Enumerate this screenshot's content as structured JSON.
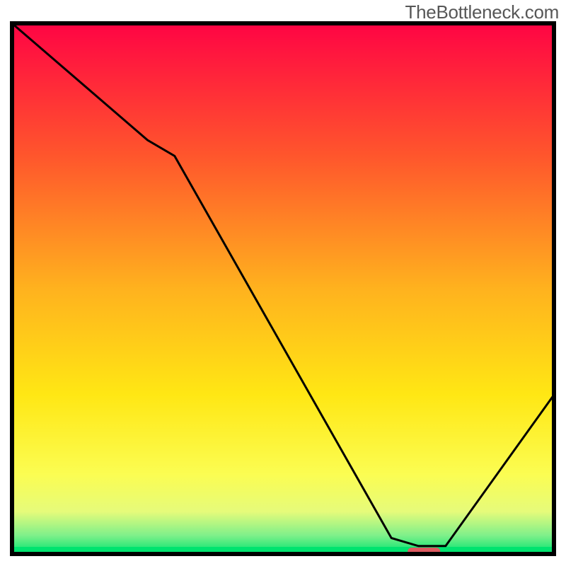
{
  "watermark": "TheBottleneck.com",
  "chart_data": {
    "type": "line",
    "title": "",
    "xlabel": "",
    "ylabel": "",
    "xlim": [
      0,
      100
    ],
    "ylim": [
      0,
      100
    ],
    "x": [
      0,
      25,
      30,
      70,
      75,
      80,
      100
    ],
    "values": [
      100,
      78,
      75,
      3,
      1.5,
      1.5,
      30
    ],
    "marker": {
      "x": 76,
      "y": 0.5,
      "w": 6,
      "h": 1.4
    },
    "gradient_stops": [
      {
        "offset": 0.0,
        "color": "#ff0444"
      },
      {
        "offset": 0.25,
        "color": "#ff562c"
      },
      {
        "offset": 0.5,
        "color": "#ffb21e"
      },
      {
        "offset": 0.7,
        "color": "#ffe714"
      },
      {
        "offset": 0.85,
        "color": "#fbfd52"
      },
      {
        "offset": 0.92,
        "color": "#e6fb7a"
      },
      {
        "offset": 0.965,
        "color": "#7ff08a"
      },
      {
        "offset": 1.0,
        "color": "#00e36f"
      }
    ]
  }
}
